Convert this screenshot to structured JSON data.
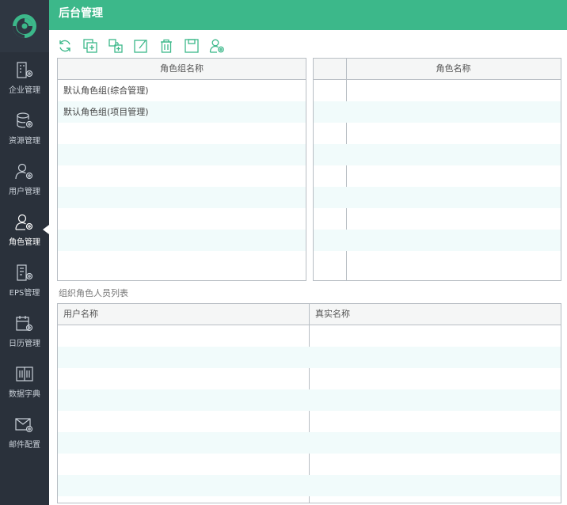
{
  "header": {
    "title": "后台管理"
  },
  "sidebar": {
    "items": [
      {
        "label": "企业管理",
        "icon": "enterprise-settings-icon"
      },
      {
        "label": "资源管理",
        "icon": "database-settings-icon"
      },
      {
        "label": "用户管理",
        "icon": "user-settings-icon"
      },
      {
        "label": "角色管理",
        "icon": "role-settings-icon",
        "active": true
      },
      {
        "label": "EPS管理",
        "icon": "eps-settings-icon"
      },
      {
        "label": "日历管理",
        "icon": "calendar-settings-icon"
      },
      {
        "label": "数据字典",
        "icon": "book-icon"
      },
      {
        "label": "邮件配置",
        "icon": "mail-settings-icon"
      }
    ]
  },
  "toolbar": {
    "icons": [
      "refresh-icon",
      "copy-add-icon",
      "group-add-icon",
      "edit-icon",
      "delete-icon",
      "save-icon",
      "user-role-icon"
    ]
  },
  "role_group_table": {
    "header": "角色组名称",
    "rows": [
      "默认角色组(综合管理)",
      "默认角色组(项目管理)",
      "",
      "",
      "",
      "",
      "",
      "",
      ""
    ]
  },
  "role_table": {
    "headers": [
      "",
      "角色名称"
    ],
    "rows": [
      "",
      "",
      "",
      "",
      "",
      "",
      "",
      "",
      ""
    ]
  },
  "section": {
    "label": "组织角色人员列表"
  },
  "user_table": {
    "headers": [
      "用户名称",
      "真实名称"
    ],
    "rows": [
      [
        "",
        ""
      ],
      [
        "",
        ""
      ],
      [
        "",
        ""
      ],
      [
        "",
        ""
      ],
      [
        "",
        ""
      ],
      [
        "",
        ""
      ],
      [
        "",
        ""
      ],
      [
        "",
        ""
      ]
    ]
  },
  "colors": {
    "accent": "#3cb88a",
    "sidebar_bg": "#2a313b",
    "row_alt": "#f1fbfb"
  }
}
